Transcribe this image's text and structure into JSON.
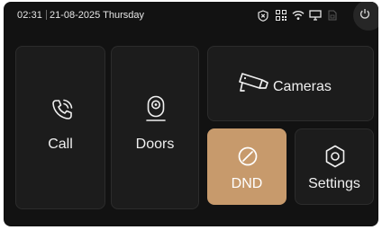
{
  "status_bar": {
    "time": "02:31",
    "date": "21-08-2025 Thursday",
    "icons": [
      "shield-x-icon",
      "qr-code-icon",
      "wifi-icon",
      "monitor-icon",
      "sim-card-icon",
      "power-icon"
    ]
  },
  "tiles": {
    "call": {
      "label": "Call",
      "icon": "phone-ringing-icon"
    },
    "doors": {
      "label": "Doors",
      "icon": "door-bell-icon"
    },
    "cameras": {
      "label": "Cameras",
      "icon": "security-camera-icon"
    },
    "dnd": {
      "label": "DND",
      "icon": "block-icon",
      "active": true
    },
    "settings": {
      "label": "Settings",
      "icon": "hexagon-gear-icon"
    }
  },
  "colors": {
    "background": "#121212",
    "tile": "#1c1c1c",
    "dnd_accent": "#c79a6c",
    "text": "#f0f0f0"
  }
}
